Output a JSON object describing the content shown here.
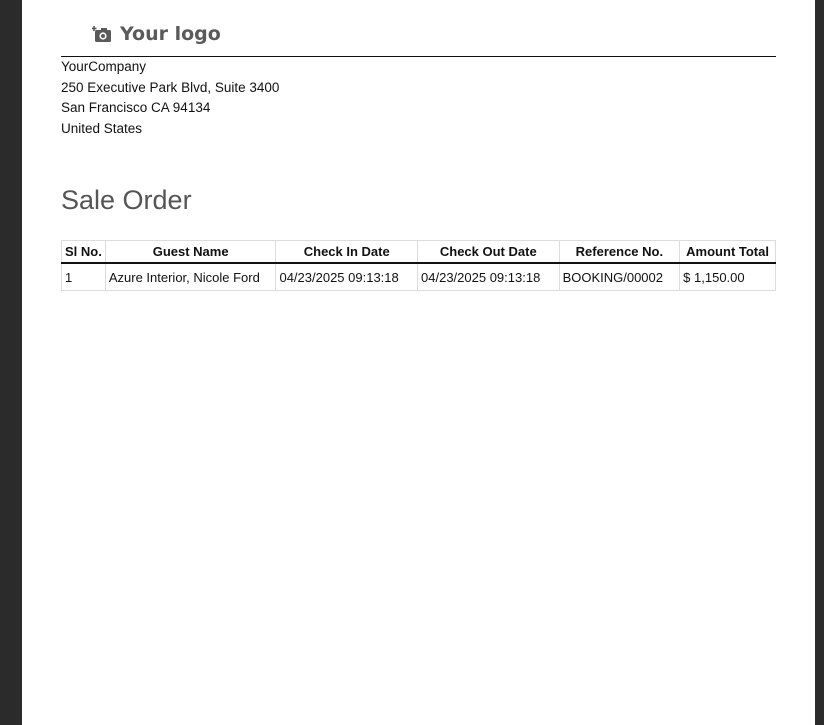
{
  "logo": {
    "text": "Your logo",
    "icon": "camera-plus-icon"
  },
  "company": {
    "name": "YourCompany",
    "street": "250 Executive Park Blvd, Suite 3400",
    "city_line": "San Francisco CA 94134",
    "country": "United States"
  },
  "document": {
    "title": "Sale Order"
  },
  "table": {
    "headers": [
      "Sl No.",
      "Guest Name",
      "Check In Date",
      "Check Out Date",
      "Reference No.",
      "Amount Total"
    ],
    "rows": [
      [
        "1",
        "Azure Interior, Nicole Ford",
        "04/23/2025 09:13:18",
        "04/23/2025 09:13:18",
        "BOOKING/00002",
        "$ 1,150.00"
      ]
    ]
  }
}
